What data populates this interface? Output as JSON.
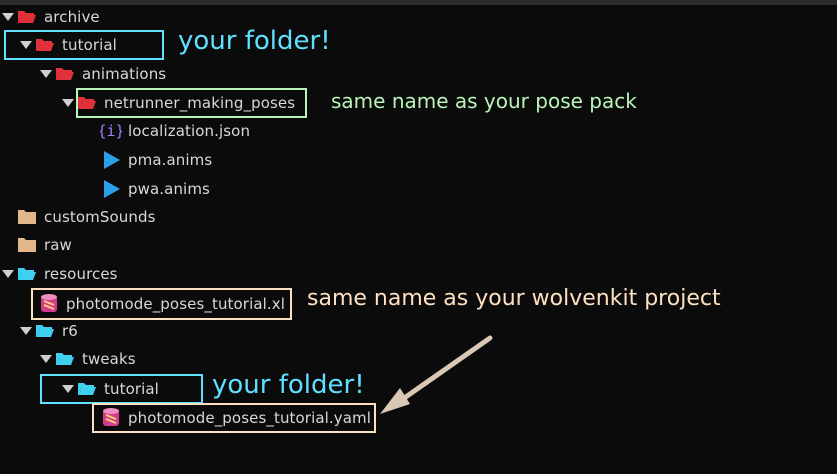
{
  "tree": {
    "archive": "archive",
    "tutorial_archive": "tutorial",
    "animations": "animations",
    "pose_folder": "netrunner_making_poses",
    "localization": "localization.json",
    "pma": "pma.anims",
    "pwa": "pwa.anims",
    "custom_sounds": "customSounds",
    "raw": "raw",
    "resources": "resources",
    "photomode_xl": "photomode_poses_tutorial.xl",
    "r6": "r6",
    "tweaks": "tweaks",
    "tutorial_tweaks": "tutorial",
    "photomode_yaml": "photomode_poses_tutorial.yaml"
  },
  "annotations": {
    "your_folder_1": "your folder!",
    "same_pose_pack": "same name as your pose pack",
    "same_wolvenkit": "same name as your wolvenkit project",
    "your_folder_2": "your folder!"
  },
  "colors": {
    "red_folder": "#e0303a",
    "tan_folder": "#e0b68a",
    "cyan_folder": "#3fd0f0",
    "cyan_annotation": "#5fe0ff",
    "green_annotation": "#b8f5b8",
    "peach_annotation": "#ffe0c0",
    "json_icon": "#a07cff",
    "anim_icon": "#2ba0e8",
    "yaml_icon": "#d23c8c"
  }
}
